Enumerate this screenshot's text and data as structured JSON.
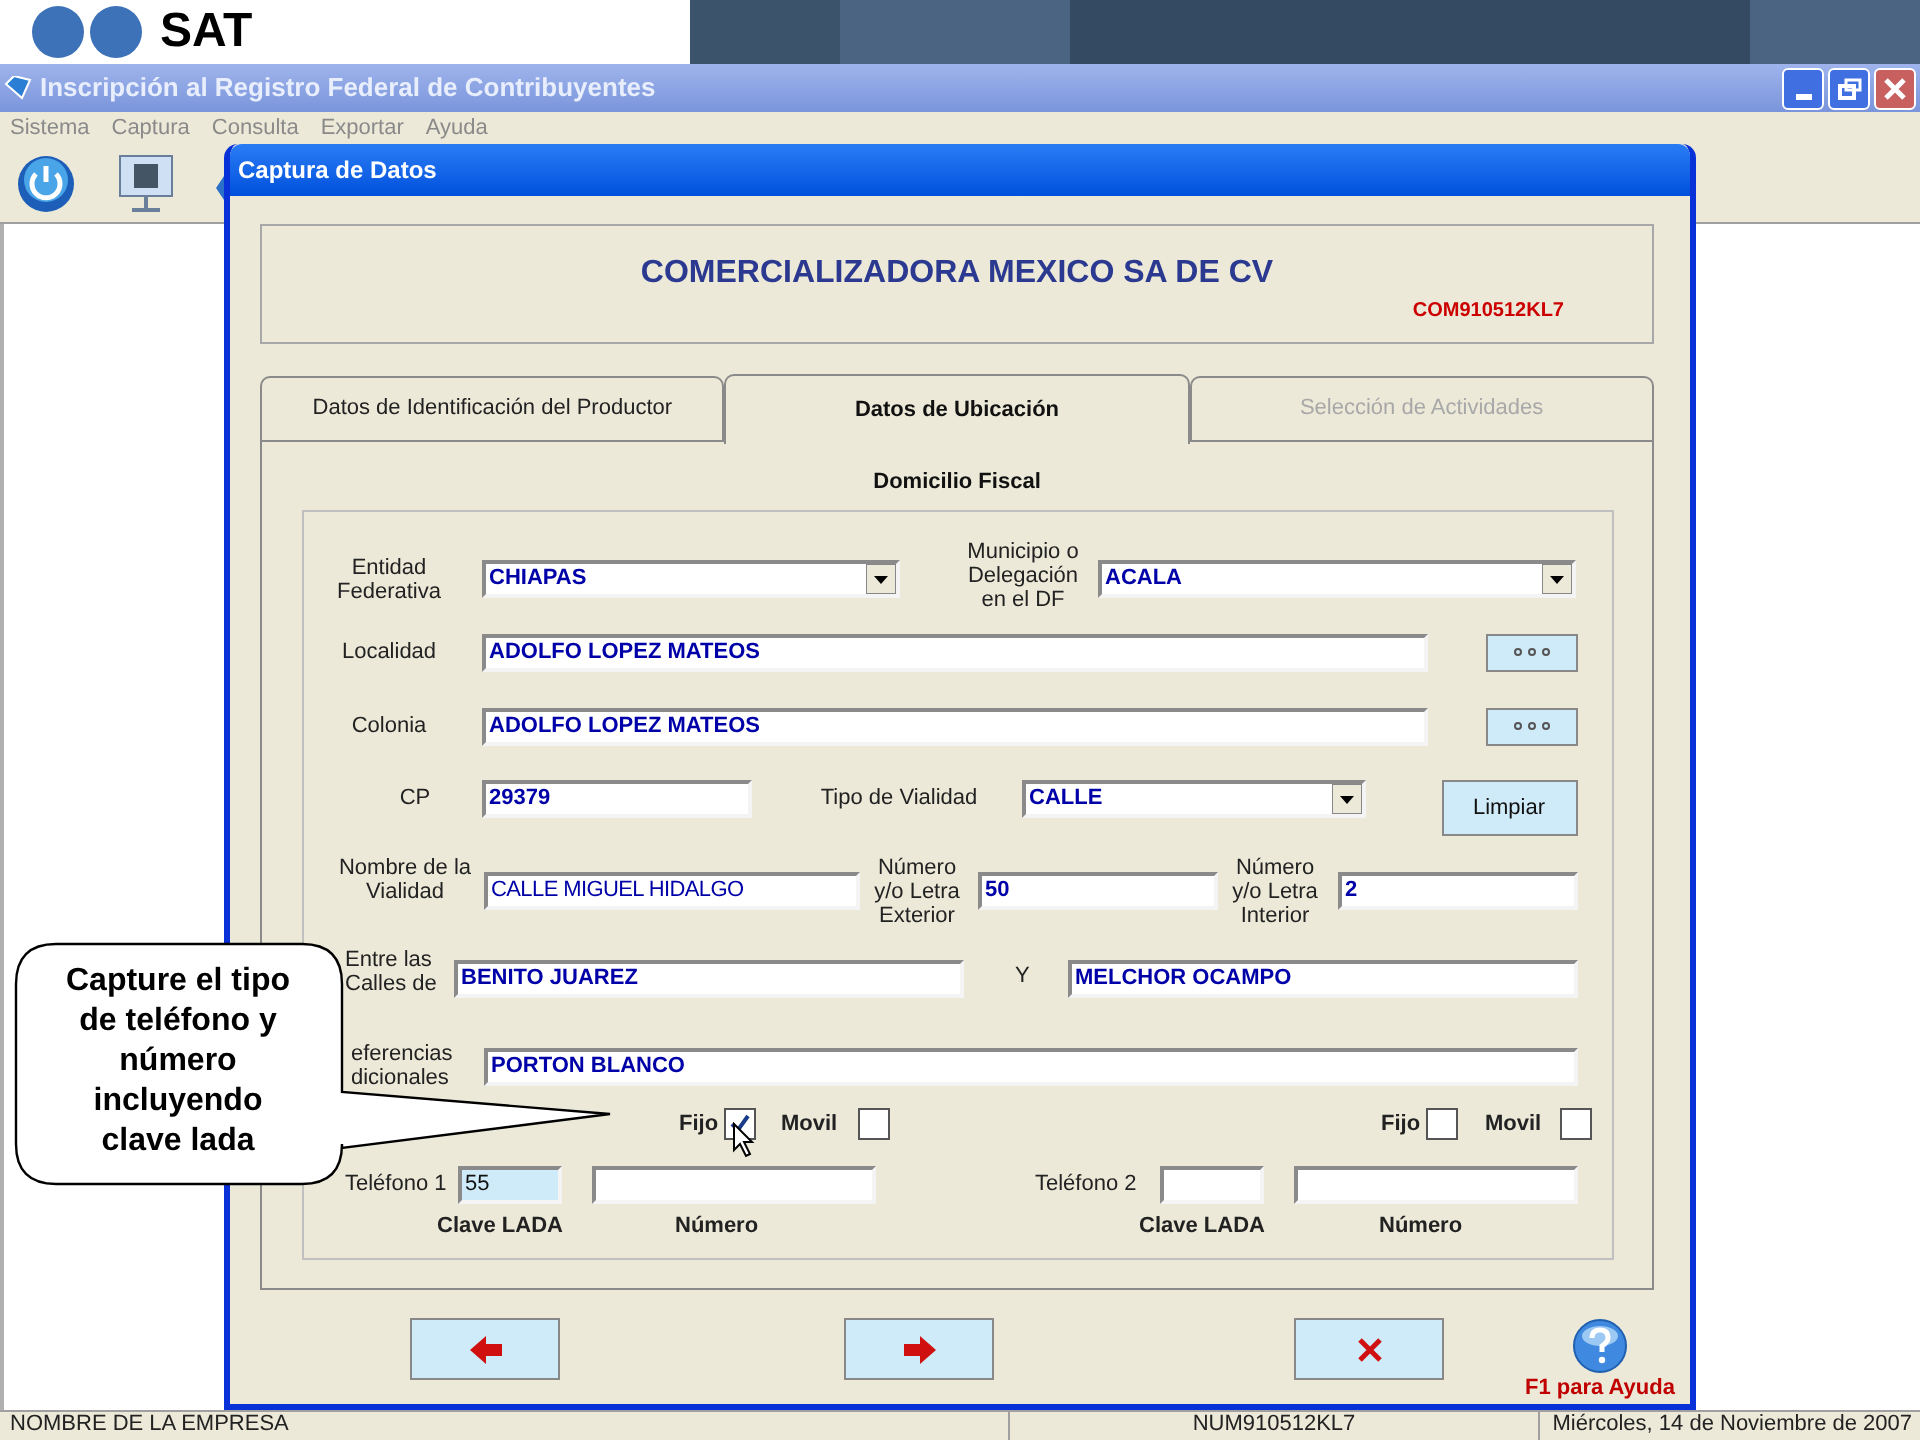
{
  "banner": {
    "logo_text": "SAT"
  },
  "window": {
    "title": "Inscripción al Registro Federal de Contribuyentes",
    "menu": [
      "Sistema",
      "Captura",
      "Consulta",
      "Exportar",
      "Ayuda"
    ]
  },
  "dialog": {
    "title": "Captura de Datos",
    "company": "COMERCIALIZADORA MEXICO SA DE CV",
    "rfc": "COM910512KL7",
    "tabs": [
      {
        "label": "Datos de Identificación del Productor",
        "selected": false,
        "disabled": false
      },
      {
        "label": "Datos de Ubicación",
        "selected": true,
        "disabled": false
      },
      {
        "label": "Selección de Actividades",
        "selected": false,
        "disabled": true
      }
    ],
    "section_title": "Domicilio Fiscal",
    "entidad": {
      "label": "Entidad\nFederativa",
      "value": "CHIAPAS"
    },
    "municipio": {
      "label": "Municipio o\nDelegación\nen el DF",
      "value": "ACALA"
    },
    "localidad": {
      "label": "Localidad",
      "value": "ADOLFO LOPEZ MATEOS"
    },
    "colonia": {
      "label": "Colonia",
      "value": "ADOLFO LOPEZ MATEOS"
    },
    "cp": {
      "label": "CP",
      "value": "29379"
    },
    "tipo_vialidad": {
      "label": "Tipo de Vialidad",
      "value": "CALLE"
    },
    "clear_button": "Limpiar",
    "vialidad": {
      "label": "Nombre de la\nVialidad",
      "value": "CALLE MIGUEL HIDALGO"
    },
    "num_exterior": {
      "label": "Número\ny/o Letra\nExterior",
      "value": "50"
    },
    "num_interior": {
      "label": "Número\ny/o Letra\nInterior",
      "value": "2"
    },
    "entre_calles": {
      "label": "Entre las\nCalles de",
      "value": "BENITO JUAREZ"
    },
    "y_calle": {
      "label": "Y",
      "value": "MELCHOR OCAMPO"
    },
    "referencias": {
      "label": "eferencias\ndicionales",
      "value": "PORTON BLANCO"
    },
    "phones": [
      {
        "fixed_label": "Fijo",
        "fixed_checked": true,
        "mobile_label": "Movil",
        "mobile_checked": false,
        "label": "Teléfono 1",
        "lada": "55",
        "lada_focused": true,
        "lada_caption": "Clave LADA",
        "number_caption": "Número"
      },
      {
        "fixed_label": "Fijo",
        "fixed_checked": false,
        "mobile_label": "Movil",
        "mobile_checked": false,
        "label": "Teléfono 2",
        "lada_focused": false,
        "lada_caption": "Clave LADA",
        "number_caption": "Número"
      }
    ],
    "help_text": "F1 para Ayuda"
  },
  "callout": {
    "text": "Capture el tipo\nde teléfono y\nnúmero\nincluyendo\nclave lada"
  },
  "status_bar": [
    "NOMBRE DE LA EMPRESA",
    "NUM910512KL7",
    "Miércoles, 14 de Noviembre de 2007"
  ]
}
